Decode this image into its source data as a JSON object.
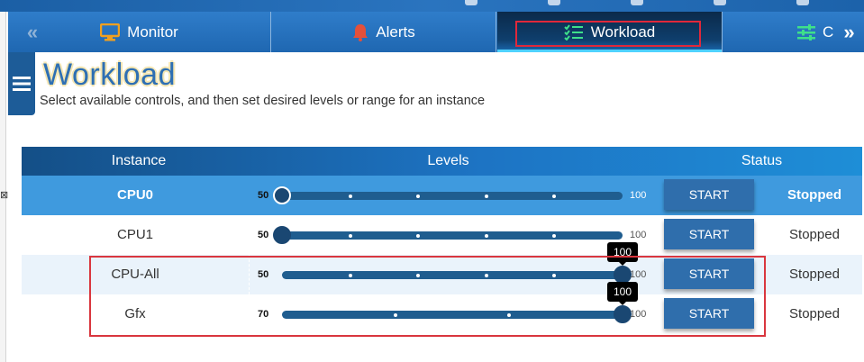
{
  "tabs": [
    {
      "label": "Monitor",
      "icon": "monitor-icon"
    },
    {
      "label": "Alerts",
      "icon": "bell-icon"
    },
    {
      "label": "Workload",
      "icon": "checklist-icon",
      "active": true
    },
    {
      "label": "C",
      "icon": "sliders-icon"
    }
  ],
  "page": {
    "title": "Workload",
    "subtitle": "Select available controls, and then set desired levels or range for an instance"
  },
  "table": {
    "headers": {
      "instance": "Instance",
      "levels": "Levels",
      "status": "Status"
    },
    "rows": [
      {
        "name": "CPU0",
        "min": "50",
        "max": "100",
        "level": 0,
        "start_label": "START",
        "status": "Stopped",
        "selected": true
      },
      {
        "name": "CPU1",
        "min": "50",
        "max": "100",
        "level": 0,
        "start_label": "START",
        "status": "Stopped"
      },
      {
        "name": "CPU-All",
        "min": "50",
        "max": "100",
        "level": 100,
        "tooltip": "100",
        "start_label": "START",
        "status": "Stopped"
      },
      {
        "name": "Gfx",
        "min": "70",
        "max": "100",
        "level": 100,
        "tooltip": "100",
        "start_label": "START",
        "status": "Stopped"
      }
    ]
  },
  "colors": {
    "accent": "#2f6eac",
    "header_start": "#144f87",
    "selected_row": "#3f9ade",
    "highlight_box": "#d9363e",
    "title": "#2e6fb3"
  }
}
